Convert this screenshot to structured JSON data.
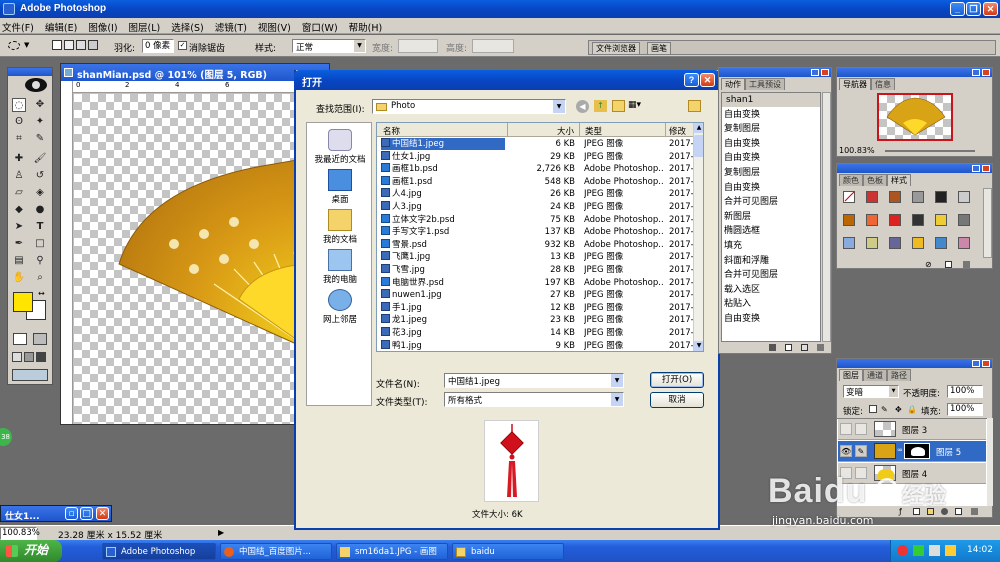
{
  "app": {
    "title": "Adobe Photoshop"
  },
  "menu": {
    "items": [
      "文件(F)",
      "编辑(E)",
      "图像(I)",
      "图层(L)",
      "选择(S)",
      "滤镜(T)",
      "视图(V)",
      "窗口(W)",
      "帮助(H)"
    ]
  },
  "options": {
    "feather_label": "羽化:",
    "feather_value": "0 像素",
    "antialias_label": "消除锯齿",
    "style_label": "样式:",
    "style_value": "正常",
    "width_label": "宽度:",
    "height_label": "高度:",
    "file_browser": "文件浏览器",
    "brushes": "画笔"
  },
  "document": {
    "title": "shanMian.psd @ 101% (图层 5, RGB)",
    "zoom": "100.83%",
    "dimensions": "23.28 厘米 x 15.52 厘米",
    "ruler": [
      "0",
      "2",
      "4",
      "6"
    ]
  },
  "minimized_doc": {
    "title": "仕女1..."
  },
  "dialog": {
    "title": "打开",
    "lookin_label": "查找范围(I):",
    "lookin_value": "Photo",
    "places": [
      "我最近的文档",
      "桌面",
      "我的文档",
      "我的电脑",
      "网上邻居"
    ],
    "columns": [
      "名称",
      "大小",
      "类型",
      "修改"
    ],
    "files": [
      {
        "name": "中国结1.jpeg",
        "size": "6 KB",
        "type": "JPEG 图像",
        "date": "2017-",
        "icon": "jpg"
      },
      {
        "name": "仕女1.jpg",
        "size": "29 KB",
        "type": "JPEG 图像",
        "date": "2017-",
        "icon": "jpg"
      },
      {
        "name": "画框1b.psd",
        "size": "2,726 KB",
        "type": "Adobe Photoshop...",
        "date": "2017-",
        "icon": "psd"
      },
      {
        "name": "画框1.psd",
        "size": "548 KB",
        "type": "Adobe Photoshop...",
        "date": "2017-",
        "icon": "psd"
      },
      {
        "name": "人4.jpg",
        "size": "26 KB",
        "type": "JPEG 图像",
        "date": "2017-",
        "icon": "jpg"
      },
      {
        "name": "人3.jpg",
        "size": "24 KB",
        "type": "JPEG 图像",
        "date": "2017-",
        "icon": "jpg"
      },
      {
        "name": "立体文字2b.psd",
        "size": "75 KB",
        "type": "Adobe Photoshop...",
        "date": "2017-",
        "icon": "psd"
      },
      {
        "name": "手写文字1.psd",
        "size": "137 KB",
        "type": "Adobe Photoshop...",
        "date": "2017-",
        "icon": "psd"
      },
      {
        "name": "雪景.psd",
        "size": "932 KB",
        "type": "Adobe Photoshop...",
        "date": "2017-",
        "icon": "psd"
      },
      {
        "name": "飞鹰1.jpg",
        "size": "13 KB",
        "type": "JPEG 图像",
        "date": "2017-",
        "icon": "jpg"
      },
      {
        "name": "飞雪.jpg",
        "size": "28 KB",
        "type": "JPEG 图像",
        "date": "2017-",
        "icon": "jpg"
      },
      {
        "name": "电脑世界.psd",
        "size": "197 KB",
        "type": "Adobe Photoshop...",
        "date": "2017-",
        "icon": "psd"
      },
      {
        "name": "nuwen1.jpg",
        "size": "27 KB",
        "type": "JPEG 图像",
        "date": "2017-",
        "icon": "jpg"
      },
      {
        "name": "手1.jpg",
        "size": "12 KB",
        "type": "JPEG 图像",
        "date": "2017-",
        "icon": "jpg"
      },
      {
        "name": "龙1.jpeg",
        "size": "23 KB",
        "type": "JPEG 图像",
        "date": "2017-",
        "icon": "jpg"
      },
      {
        "name": "花3.jpg",
        "size": "14 KB",
        "type": "JPEG 图像",
        "date": "2017-",
        "icon": "jpg"
      },
      {
        "name": "鸭1.jpg",
        "size": "9 KB",
        "type": "JPEG 图像",
        "date": "2017-",
        "icon": "jpg"
      }
    ],
    "filename_label": "文件名(N):",
    "filename_value": "中国结1.jpeg",
    "filetype_label": "文件类型(T):",
    "filetype_value": "所有格式",
    "open_button": "打开(O)",
    "cancel_button": "取消",
    "filesize": "文件大小: 6K"
  },
  "actions_panel": {
    "tabs": [
      "动作",
      "工具预设"
    ],
    "items": [
      "shan1",
      "自由变换",
      "复制图层",
      "自由变换",
      "自由变换",
      "复制图层",
      "自由变换",
      "合并可见图层",
      "新图层",
      "椭圆选框",
      "填充",
      "斜面和浮雕",
      "合并可见图层",
      "载入选区",
      "粘贴入",
      "自由变换"
    ]
  },
  "navigator": {
    "tabs": [
      "导航器",
      "信息"
    ],
    "zoom": "100.83%"
  },
  "styles_panel": {
    "tabs": [
      "颜色",
      "色板",
      "样式"
    ]
  },
  "layers_panel": {
    "tabs": [
      "图层",
      "通道",
      "路径"
    ],
    "blend": "变暗",
    "opacity_label": "不透明度:",
    "opacity": "100%",
    "lock_label": "锁定:",
    "fill_label": "填充:",
    "fill": "100%",
    "layers": [
      "图层 3",
      "图层 5",
      "图层 4"
    ]
  },
  "taskbar": {
    "start": "开始",
    "tasks": [
      "Adobe Photoshop",
      "中国结_百度图片...",
      "sm16da1.JPG - 画图",
      "baidu"
    ],
    "time": "14:02"
  },
  "watermark": {
    "brand": "Baidu",
    "jingyan": "经验",
    "url": "jingyan.baidu.com"
  },
  "colors": {
    "foreground": "#ffe500",
    "background": "#ffffff",
    "titlebar": "#0a52d8",
    "taskbar": "#245edb"
  }
}
